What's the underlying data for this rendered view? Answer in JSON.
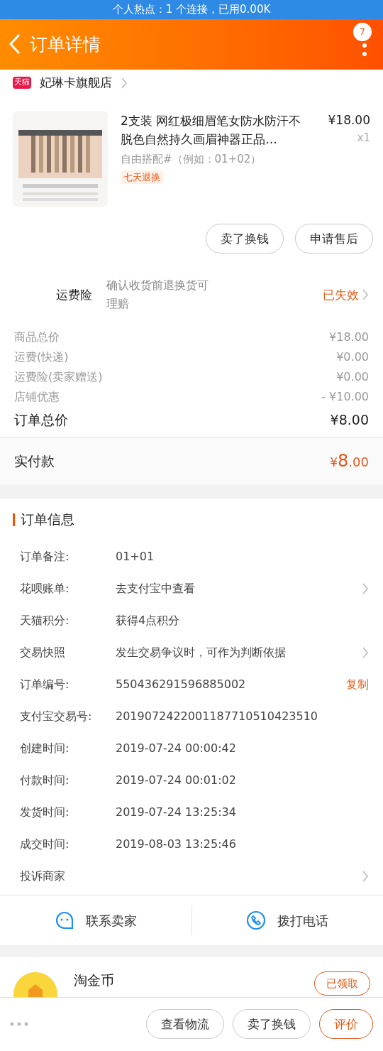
{
  "status_bar": {
    "text": "个人热点：1 个连接，已用0.00K"
  },
  "header": {
    "title": "订单详情",
    "badge": "7"
  },
  "store": {
    "badge": "天猫",
    "name": "妃琳卡旗舰店"
  },
  "product": {
    "title": "2支装 网红极细眉笔女防水防汗不脱色自然持久画眉神器正品…",
    "price": "¥18.00",
    "qty": "x1",
    "sku": "自由搭配#（例如：01+02）",
    "tag": "七天退换"
  },
  "item_actions": [
    "卖了换钱",
    "申请售后"
  ],
  "insurance": {
    "label": "运费险",
    "desc": "确认收货前退换货可理赔",
    "status": "已失效"
  },
  "price_rows": [
    {
      "label": "商品总价",
      "value": "¥18.00"
    },
    {
      "label": "运费(快递)",
      "value": "¥0.00"
    },
    {
      "label": "运费险(卖家赠送)",
      "value": "¥0.00"
    },
    {
      "label": "店铺优惠",
      "value": "- ¥10.00"
    }
  ],
  "order_total": {
    "label": "订单总价",
    "value": "¥8.00"
  },
  "paid": {
    "label": "实付款",
    "currency": "¥",
    "integer": "8",
    "decimal": ".00"
  },
  "order_info": {
    "title": "订单信息",
    "rows": [
      {
        "label": "订单备注:",
        "value": "01+01",
        "kind": "plain"
      },
      {
        "label": "花呗账单:",
        "value": "去支付宝中查看",
        "kind": "link"
      },
      {
        "label": "天猫积分:",
        "value": "获得4点积分",
        "kind": "plain"
      },
      {
        "label": "交易快照",
        "value": "发生交易争议时，可作为判断依据",
        "kind": "link"
      },
      {
        "label": "订单编号:",
        "value": "550436291596885002",
        "kind": "copy",
        "action": "复制"
      },
      {
        "label": "支付宝交易号:",
        "value": "2019072422001187710510423510",
        "kind": "plain"
      },
      {
        "label": "创建时间:",
        "value": "2019-07-24 00:00:42",
        "kind": "plain"
      },
      {
        "label": "付款时间:",
        "value": "2019-07-24 00:01:02",
        "kind": "plain"
      },
      {
        "label": "发货时间:",
        "value": "2019-07-24 13:25:34",
        "kind": "plain"
      },
      {
        "label": "成交时间:",
        "value": "2019-08-03 13:25:46",
        "kind": "plain"
      },
      {
        "label": "投诉商家",
        "kind": "link"
      }
    ]
  },
  "contact": [
    {
      "label": "联系卖家",
      "kind": "chat"
    },
    {
      "label": "拨打电话",
      "kind": "phone"
    }
  ],
  "coins": {
    "title": "淘金币",
    "button": "已领取"
  },
  "bottom_bar": {
    "buttons": [
      {
        "label": "查看物流",
        "kind": "normal"
      },
      {
        "label": "卖了换钱",
        "kind": "normal"
      },
      {
        "label": "评价",
        "kind": "primary"
      }
    ]
  }
}
